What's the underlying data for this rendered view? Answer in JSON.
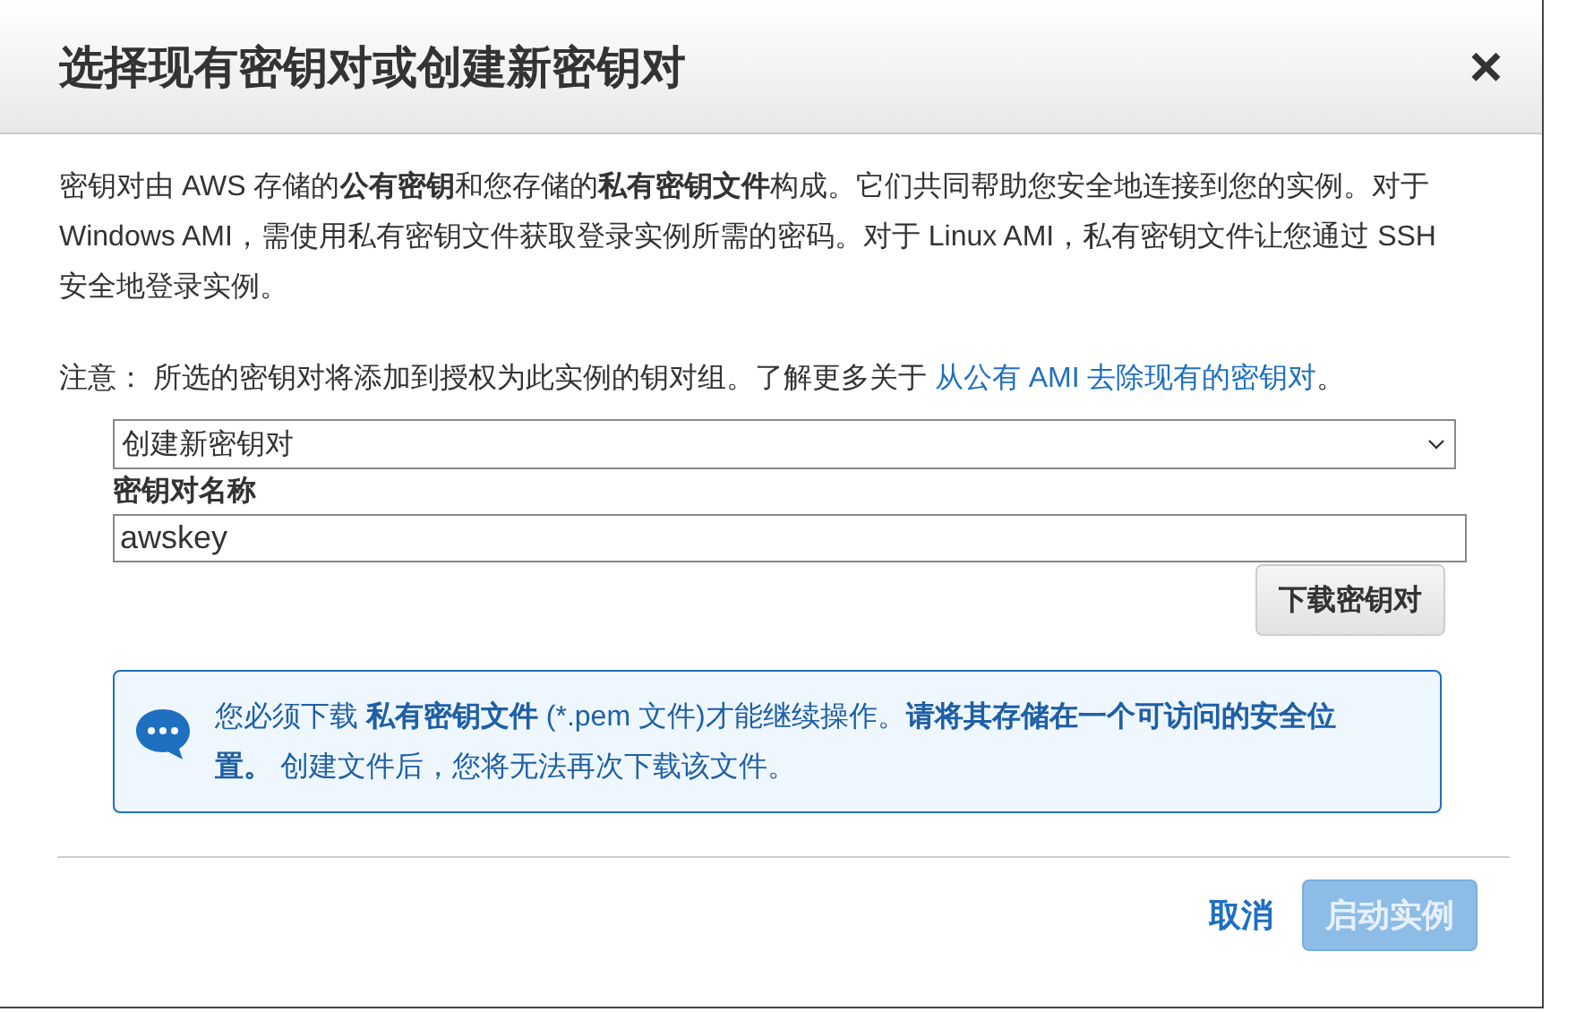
{
  "dialog": {
    "title": "选择现有密钥对或创建新密钥对",
    "close": "×"
  },
  "intro": "密钥对由 AWS 存储的**公有密钥**和您存储的**私有密钥文件**构成。它们共同帮助您安全地连接到您的实例。对于 Windows AMI，需使用私有密钥文件获取登录实例所需的密码。对于 Linux AMI，私有密钥文件让您通过 SSH 安全地登录实例。",
  "note": {
    "text": "注意： 所选的密钥对将添加到授权为此实例的钥对组。了解更多关于 ",
    "link": "从公有 AMI 去除现有的密钥对",
    "end": "。"
  },
  "key_pair_select": {
    "value": "创建新密钥对"
  },
  "key_pair_name": {
    "label": "密钥对名称",
    "value": "awskey"
  },
  "download_button": "下载密钥对",
  "info": "您必须下载 **私有密钥文件** (*.pem 文件)才能继续操作。**请将其存储在一个可访问的安全位置。** 创建文件后，您将无法再次下载该文件。",
  "buttons": [
    {
      "label": "取消",
      "kind": "link",
      "disabled": false
    },
    {
      "label": "启动实例",
      "kind": "primary",
      "disabled": true
    }
  ]
}
